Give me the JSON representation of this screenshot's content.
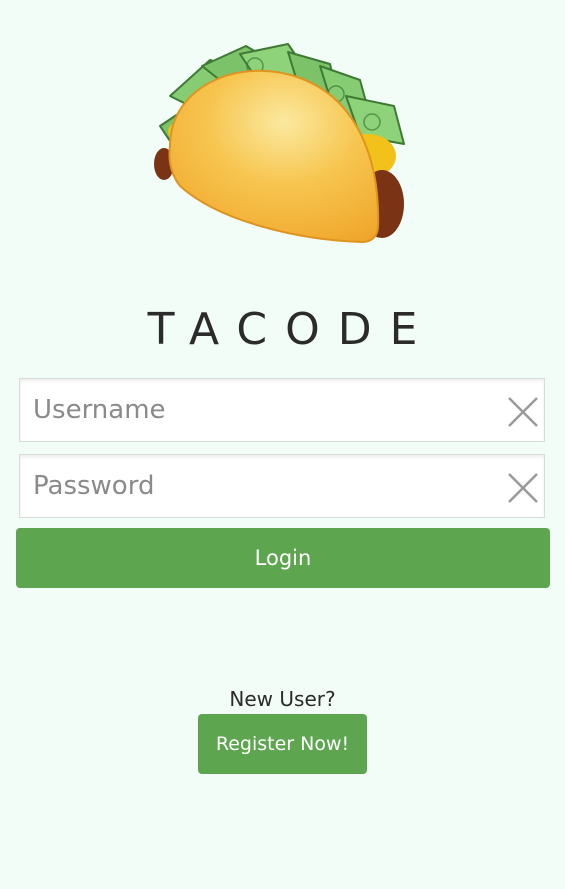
{
  "app": {
    "title": "TACODE",
    "logo_icon": "taco-with-money-icon"
  },
  "login_form": {
    "username": {
      "placeholder": "Username",
      "value": "",
      "clear_icon": "clear-x-icon"
    },
    "password": {
      "placeholder": "Password",
      "value": "",
      "clear_icon": "clear-x-icon"
    },
    "login_label": "Login"
  },
  "register": {
    "prompt": "New User?",
    "button_label": "Register Now!"
  },
  "colors": {
    "background": "#f3fdf7",
    "accent_green": "#5ea550",
    "title_text": "#2b2b2b",
    "taco_shell": "#f5b43a",
    "money_green": "#7cc46a"
  }
}
